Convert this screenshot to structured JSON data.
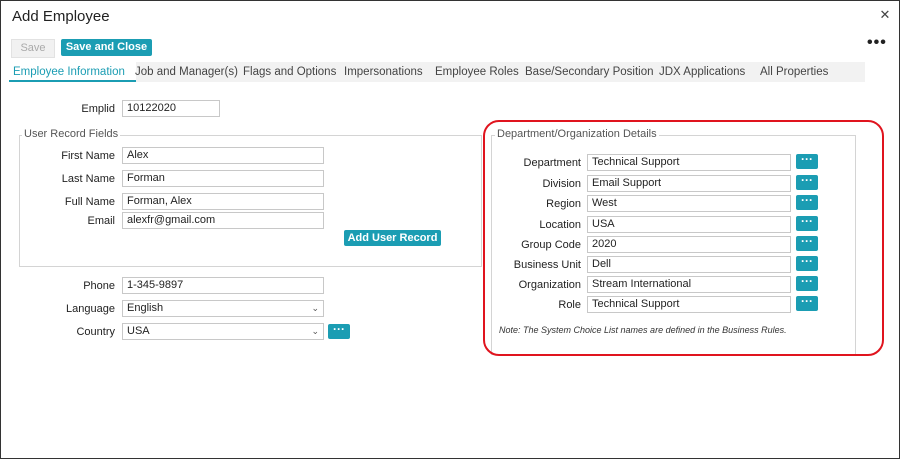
{
  "window": {
    "title": "Add Employee"
  },
  "toolbar": {
    "save_label": "Save",
    "save_close_label": "Save and Close"
  },
  "tabs": [
    {
      "label": "Employee Information",
      "active": true
    },
    {
      "label": "Job and Manager(s)"
    },
    {
      "label": "Flags and Options"
    },
    {
      "label": "Impersonations"
    },
    {
      "label": "Employee Roles"
    },
    {
      "label": "Base/Secondary Position"
    },
    {
      "label": "JDX Applications"
    },
    {
      "label": "All Properties"
    }
  ],
  "emplid": {
    "label": "Emplid",
    "value": "10122020"
  },
  "user_record": {
    "legend": "User Record Fields",
    "fields": [
      {
        "label": "First Name",
        "value": "Alex"
      },
      {
        "label": "Last Name",
        "value": "Forman"
      },
      {
        "label": "Full Name",
        "value": "Forman, Alex"
      },
      {
        "label": "Email",
        "value": "alexfr@gmail.com"
      }
    ],
    "add_button": "Add User Record"
  },
  "contact": {
    "phone": {
      "label": "Phone",
      "value": "1-345-9897"
    },
    "language": {
      "label": "Language",
      "value": "English"
    },
    "country": {
      "label": "Country",
      "value": "USA"
    }
  },
  "dept": {
    "legend": "Department/Organization Details",
    "fields": [
      {
        "label": "Department",
        "value": "Technical Support"
      },
      {
        "label": "Division",
        "value": "Email Support"
      },
      {
        "label": "Region",
        "value": "West"
      },
      {
        "label": "Location",
        "value": "USA"
      },
      {
        "label": "Group Code",
        "value": "2020"
      },
      {
        "label": "Business Unit",
        "value": "Dell"
      },
      {
        "label": "Organization",
        "value": "Stream International"
      },
      {
        "label": "Role",
        "value": "Technical Support"
      }
    ],
    "note": "Note: The System Choice List names are defined in the Business Rules."
  },
  "colors": {
    "accent": "#1b9db3",
    "highlight": "#e0141e"
  }
}
